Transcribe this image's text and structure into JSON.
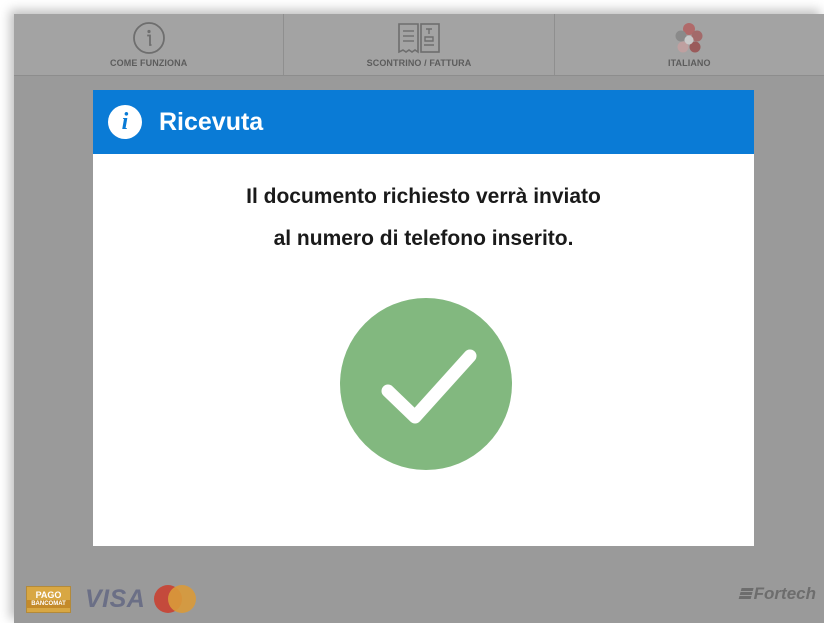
{
  "topbar": {
    "items": [
      {
        "label": "COME FUNZIONA",
        "icon": "info-icon"
      },
      {
        "label": "SCONTRINO / FATTURA",
        "icon": "receipt-icon"
      },
      {
        "label": "ITALIANO",
        "icon": "language-flags-icon"
      }
    ]
  },
  "dialog": {
    "icon": "info-icon",
    "title": "Ricevuta",
    "message_line1": "Il documento richiesto verrà inviato",
    "message_line2": "al numero di telefono inserito.",
    "success_icon": "checkmark-icon"
  },
  "footer": {
    "payment_bancomat_top": "PAGO",
    "payment_bancomat_bottom": "BANCOMAT",
    "payment_visa": "VISA",
    "brand": "Fortech"
  },
  "colors": {
    "header_blue": "#0a7bd6",
    "success_green": "#82b87f",
    "overlay_gray": "#9a9a9a"
  }
}
